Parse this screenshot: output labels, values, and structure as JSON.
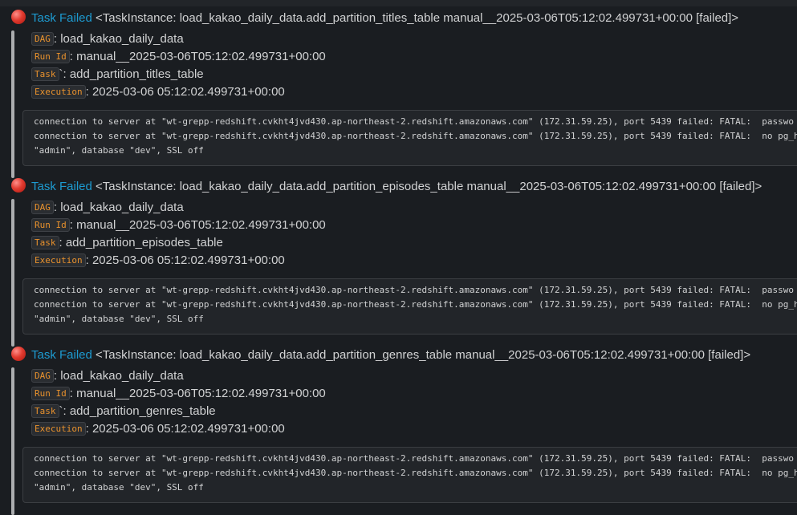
{
  "colors": {
    "background": "#1a1d21",
    "link": "#1d9bd1",
    "tag_text": "#e8912d",
    "status_icon": "#e23b30",
    "quote_bar": "#abadaf"
  },
  "icons": {
    "status": "red-circle-icon"
  },
  "messages": [
    {
      "status_label": "Task Failed",
      "header": "<TaskInstance: load_kakao_daily_data.add_partition_titles_table manual__2025-03-06T05:12:02.499731+00:00 [failed]>",
      "fields": [
        {
          "tag": "DAG",
          "sep": ": ",
          "value": "load_kakao_daily_data"
        },
        {
          "tag": "Run Id",
          "sep": ": ",
          "value": "manual__2025-03-06T05:12:02.499731+00:00"
        },
        {
          "tag": "Task",
          "sep": "`: ",
          "value": "add_partition_titles_table"
        },
        {
          "tag": "Execution",
          "sep": ": ",
          "value": "2025-03-06 05:12:02.499731+00:00"
        }
      ],
      "code_lines": [
        "connection to server at \"wt-grepp-redshift.cvkht4jvd430.ap-northeast-2.redshift.amazonaws.com\" (172.31.59.25), port 5439 failed: FATAL:  passwo",
        "connection to server at \"wt-grepp-redshift.cvkht4jvd430.ap-northeast-2.redshift.amazonaws.com\" (172.31.59.25), port 5439 failed: FATAL:  no pg_h",
        "\"admin\", database \"dev\", SSL off"
      ]
    },
    {
      "status_label": "Task Failed",
      "header": "<TaskInstance: load_kakao_daily_data.add_partition_episodes_table manual__2025-03-06T05:12:02.499731+00:00 [failed]>",
      "fields": [
        {
          "tag": "DAG",
          "sep": ": ",
          "value": "load_kakao_daily_data"
        },
        {
          "tag": "Run Id",
          "sep": ": ",
          "value": "manual__2025-03-06T05:12:02.499731+00:00"
        },
        {
          "tag": "Task",
          "sep": ": ",
          "value": "add_partition_episodes_table"
        },
        {
          "tag": "Execution",
          "sep": ": ",
          "value": "2025-03-06 05:12:02.499731+00:00"
        }
      ],
      "code_lines": [
        "connection to server at \"wt-grepp-redshift.cvkht4jvd430.ap-northeast-2.redshift.amazonaws.com\" (172.31.59.25), port 5439 failed: FATAL:  passwo",
        "connection to server at \"wt-grepp-redshift.cvkht4jvd430.ap-northeast-2.redshift.amazonaws.com\" (172.31.59.25), port 5439 failed: FATAL:  no pg_h",
        "\"admin\", database \"dev\", SSL off"
      ]
    },
    {
      "status_label": "Task Failed",
      "header": "<TaskInstance: load_kakao_daily_data.add_partition_genres_table manual__2025-03-06T05:12:02.499731+00:00 [failed]>",
      "fields": [
        {
          "tag": "DAG",
          "sep": ": ",
          "value": "load_kakao_daily_data"
        },
        {
          "tag": "Run Id",
          "sep": ": ",
          "value": "manual__2025-03-06T05:12:02.499731+00:00"
        },
        {
          "tag": "Task",
          "sep": "`: ",
          "value": "add_partition_genres_table"
        },
        {
          "tag": "Execution",
          "sep": ": ",
          "value": "2025-03-06 05:12:02.499731+00:00"
        }
      ],
      "code_lines": [
        "connection to server at \"wt-grepp-redshift.cvkht4jvd430.ap-northeast-2.redshift.amazonaws.com\" (172.31.59.25), port 5439 failed: FATAL:  passwo",
        "connection to server at \"wt-grepp-redshift.cvkht4jvd430.ap-northeast-2.redshift.amazonaws.com\" (172.31.59.25), port 5439 failed: FATAL:  no pg_h",
        "\"admin\", database \"dev\", SSL off"
      ]
    }
  ]
}
